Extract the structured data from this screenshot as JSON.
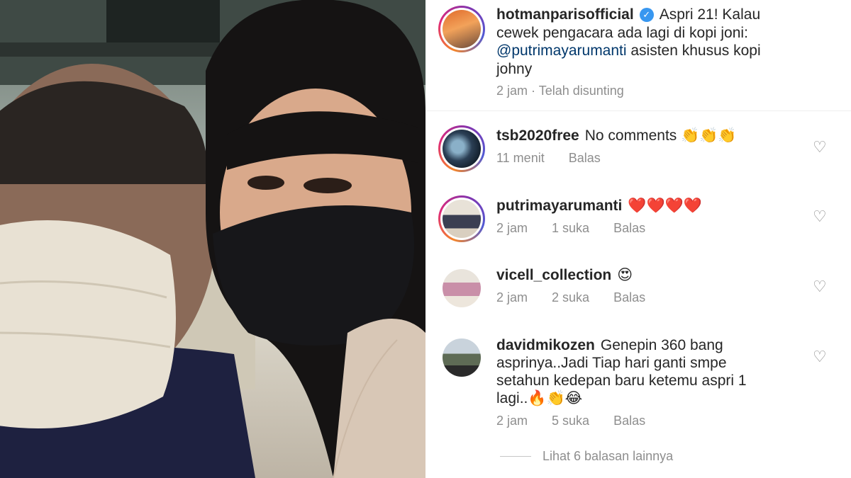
{
  "post": {
    "username": "hotmanparisofficial",
    "caption_line1": "Aspri 21! Kalau",
    "caption_line2": "cewek pengacara ada lagi di kopi joni:",
    "mention": "@putrimayarumanti",
    "caption_line3_rest": "  asisten khusus kopi",
    "caption_line4": "johny",
    "time": "2 jam",
    "edited": "Telah disunting"
  },
  "comments": [
    {
      "username": "tsb2020free",
      "text": "No comments",
      "emoji": "👏👏👏",
      "time": "11 menit",
      "likes": "",
      "reply": "Balas"
    },
    {
      "username": "putrimayarumanti",
      "text": "",
      "emoji": "❤️❤️❤️❤️",
      "time": "2 jam",
      "likes": "1 suka",
      "reply": "Balas"
    },
    {
      "username": "vicell_collection",
      "text": "",
      "emoji": "😍",
      "time": "2 jam",
      "likes": "2 suka",
      "reply": "Balas"
    },
    {
      "username": "davidmikozen",
      "line1": "Genepin 360 bang",
      "line2": "asprinya..Jadi Tiap hari ganti smpe",
      "line3": "setahun kedepan baru ketemu aspri 1",
      "line4": "lagi..",
      "emoji": "🔥👏😂",
      "time": "2 jam",
      "likes": "5 suka",
      "reply": "Balas"
    }
  ],
  "view_replies": "Lihat 6 balasan lainnya",
  "icons": {
    "like": "heart-icon",
    "verified": "verified-badge-icon"
  },
  "colors": {
    "mention": "#00376b",
    "muted": "#8e8e8e",
    "verified": "#3897f0"
  }
}
